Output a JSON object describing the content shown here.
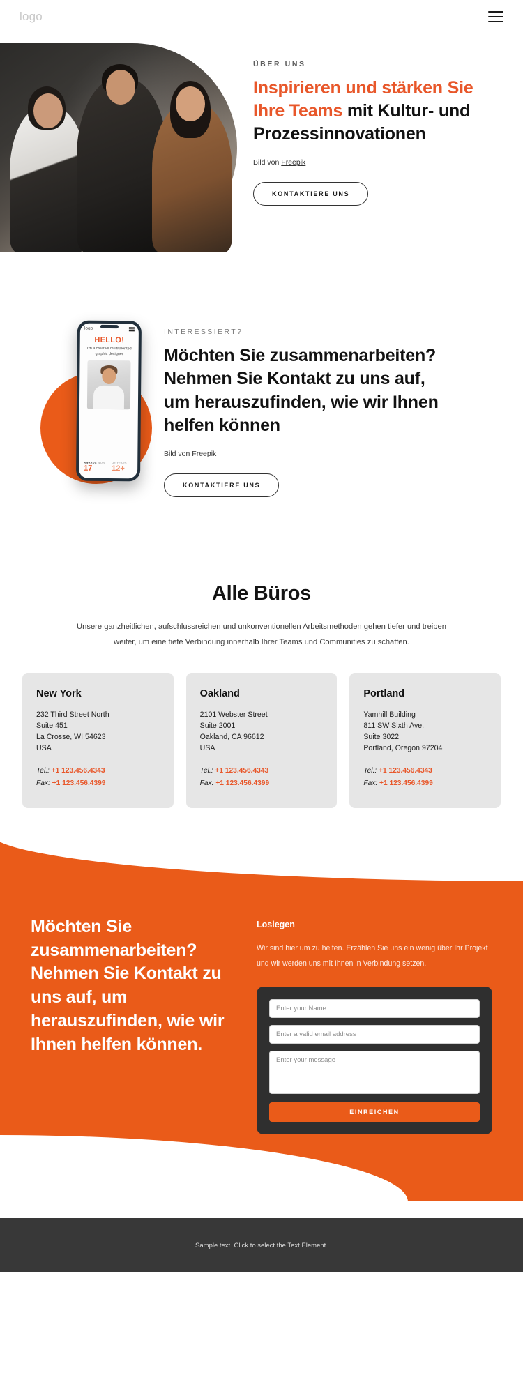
{
  "header": {
    "logo": "logo",
    "menu_icon": "hamburger-menu-icon"
  },
  "hero": {
    "eyebrow": "ÜBER UNS",
    "title_accent": "Inspirieren und stärken Sie Ihre Teams",
    "title_rest": " mit Kultur- und Prozessinnovationen",
    "credit_prefix": "Bild von ",
    "credit_link": "Freepik",
    "cta_label": "KONTAKTIERE UNS"
  },
  "section2": {
    "eyebrow": "INTERESSIERT?",
    "title": "Möchten Sie zusammenarbeiten? Nehmen Sie Kontakt zu uns auf, um herauszufinden, wie wir Ihnen helfen können",
    "credit_prefix": "Bild von ",
    "credit_link": "Freepik",
    "cta_label": "KONTAKTIERE UNS",
    "phone": {
      "logo": "logo",
      "hello": "HELLO!",
      "subtitle": "I'm a creative multitalented graphic designer",
      "stats": [
        {
          "label_bold": "AWARDS",
          "label_rest": " WON",
          "value": "17"
        },
        {
          "label_bold": "",
          "label_rest": "OF YEARS",
          "value": "12+"
        }
      ]
    }
  },
  "offices": {
    "title": "Alle Büros",
    "description": "Unsere ganzheitlichen, aufschlussreichen und unkonventionellen Arbeitsmethoden gehen tiefer und treiben weiter, um eine tiefe Verbindung innerhalb Ihrer Teams und Communities zu schaffen.",
    "cards": [
      {
        "city": "New York",
        "address": "232 Third Street North\nSuite 451\nLa Crosse, WI 54623\nUSA",
        "tel_label": "Tel.:",
        "tel": "+1 123.456.4343",
        "fax_label": "Fax:",
        "fax": "+1 123.456.4399"
      },
      {
        "city": "Oakland",
        "address": "2101 Webster Street\nSuite 2001\nOakland, CA 96612\nUSA",
        "tel_label": "Tel.:",
        "tel": "+1 123.456.4343",
        "fax_label": "Fax:",
        "fax": "+1 123.456.4399"
      },
      {
        "city": "Portland",
        "address": "Yamhill Building\n811 SW Sixth Ave.\nSuite 3022\nPortland, Oregon 97204",
        "tel_label": "Tel.:",
        "tel": "+1 123.456.4343",
        "fax_label": "Fax:",
        "fax": "+1 123.456.4399"
      }
    ]
  },
  "cta": {
    "heading": "Möchten Sie zusammenarbeiten? Nehmen Sie Kontakt zu uns auf, um herauszufinden, wie wir Ihnen helfen können.",
    "form_title": "Loslegen",
    "form_description": "Wir sind hier um zu helfen. Erzählen Sie uns ein wenig über Ihr Projekt und wir werden uns mit Ihnen in Verbindung setzen.",
    "name_placeholder": "Enter your Name",
    "email_placeholder": "Enter a valid email address",
    "message_placeholder": "Enter your message",
    "submit_label": "EINREICHEN"
  },
  "footer": {
    "text": "Sample text. Click to select the Text Element."
  },
  "colors": {
    "accent": "#ea5b19",
    "accent_text": "#e8572a",
    "card_bg": "#e6e6e6",
    "footer_bg": "#383838",
    "form_bg": "#2f2f2f"
  }
}
